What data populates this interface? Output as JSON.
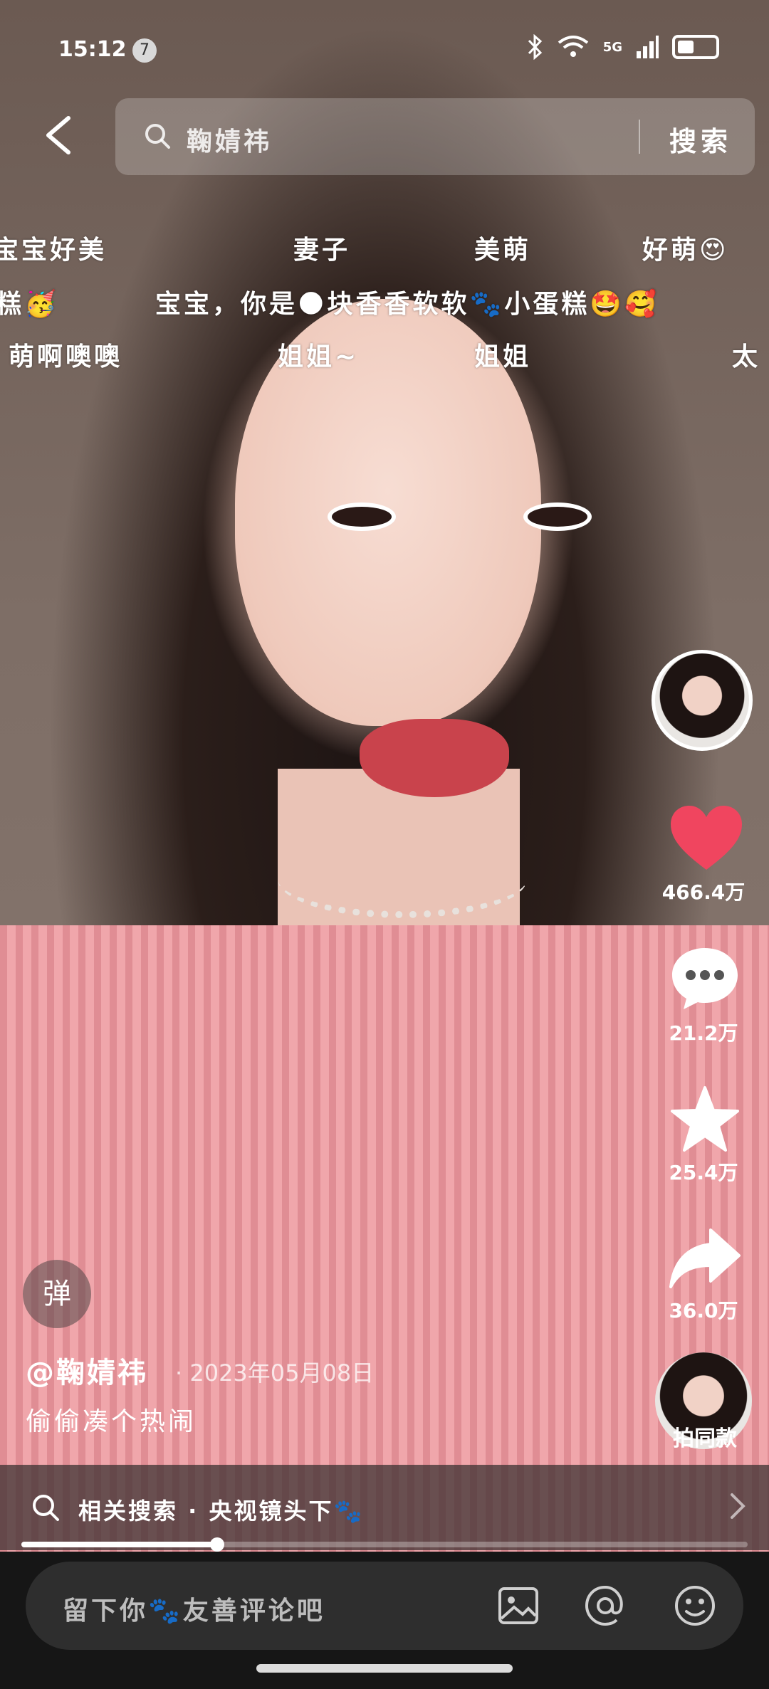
{
  "status_bar": {
    "time": "15:12",
    "notification_count": "7",
    "network": "5G"
  },
  "search": {
    "placeholder": "鞠婧祎",
    "button": "搜索"
  },
  "danmaku": {
    "row1": [
      "宝宝好美",
      "妻子",
      "美萌",
      "好萌😍"
    ],
    "row2": [
      "糕🥳",
      "宝宝，你是🌑块香香软软🐾小蛋糕🤩🥰"
    ],
    "row3": [
      "萌啊噢噢",
      "姐姐~",
      "姐姐",
      "太"
    ]
  },
  "actions": {
    "likes": "466.4万",
    "comments": "21.2万",
    "favorites": "25.4万",
    "shares": "36.0万",
    "remix_label": "拍同款"
  },
  "video_info": {
    "danmaku_toggle": "弹",
    "author": "@鞠婧祎",
    "date": "· 2023年05月08日",
    "caption": "偷偷凑个热闹"
  },
  "related_search": {
    "label": "相关搜索 · 央视镜头下🐾"
  },
  "progress": {
    "fraction": 0.27
  },
  "comment_bar": {
    "placeholder": "留下你🐾友善评论吧"
  },
  "colors": {
    "like": "#f0455f",
    "background": "#161616"
  }
}
